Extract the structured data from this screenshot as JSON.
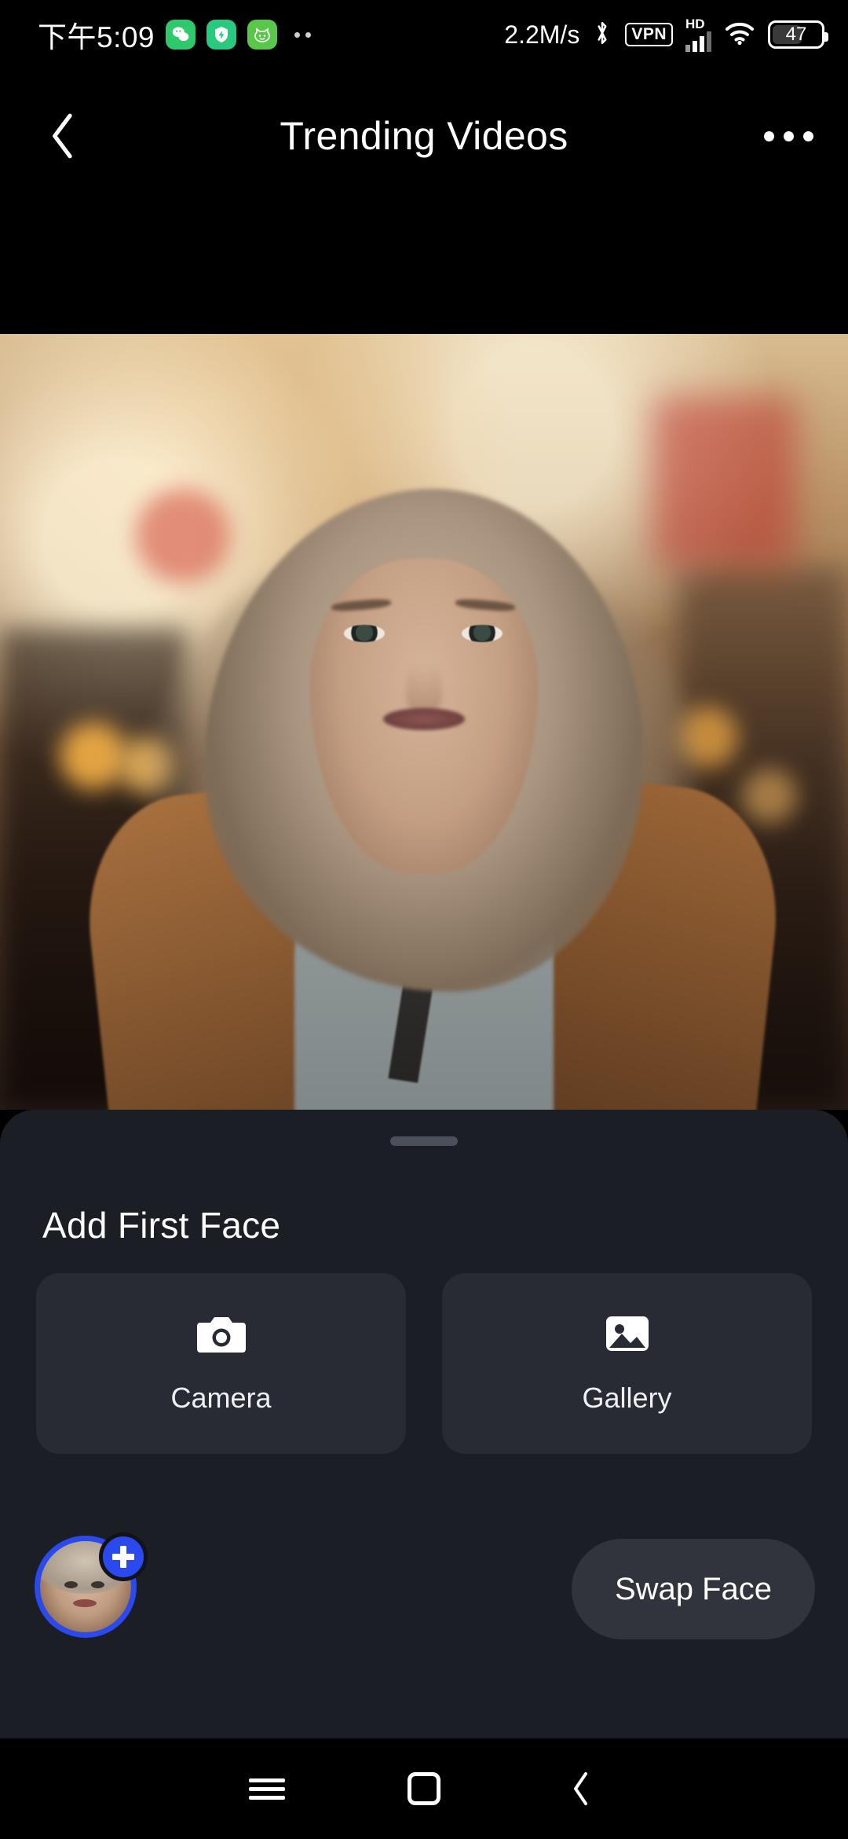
{
  "status_bar": {
    "clock": "下午5:09",
    "notification_icons": [
      "wechat-icon",
      "security-shield-icon",
      "cat-app-icon"
    ],
    "overflow_dots": "··",
    "network_speed": "2.2M/s",
    "bluetooth": "bluetooth-icon",
    "vpn": "VPN",
    "hd_label": "HD",
    "signal": "signal-bars-icon",
    "wifi": "wifi-icon",
    "battery_percent": "47"
  },
  "app_bar": {
    "back": "back-chevron-icon",
    "title": "Trending Videos",
    "overflow": "overflow-menu-icon"
  },
  "video": {
    "description": "portrait of a woman with long grey-blonde hair in a brown coat on a blurred city street"
  },
  "bottom_sheet": {
    "handle": "drag-handle",
    "title": "Add First Face",
    "options": [
      {
        "icon": "camera-icon",
        "label": "Camera"
      },
      {
        "icon": "gallery-image-icon",
        "label": "Gallery"
      }
    ],
    "face_thumbnail": {
      "name": "selected-face-avatar",
      "badge": "add-face-plus-icon",
      "ring_color": "#2a49ef"
    },
    "swap_button": "Swap Face"
  },
  "nav_bar": {
    "recents": "recents-menu-icon",
    "home": "home-square-icon",
    "back": "back-chevron-icon"
  },
  "colors": {
    "sheet_bg": "#1b1e24",
    "card_bg": "#282b33",
    "pill_bg": "#31343c",
    "accent_blue": "#2a49ef",
    "text_primary": "#ffffff"
  }
}
